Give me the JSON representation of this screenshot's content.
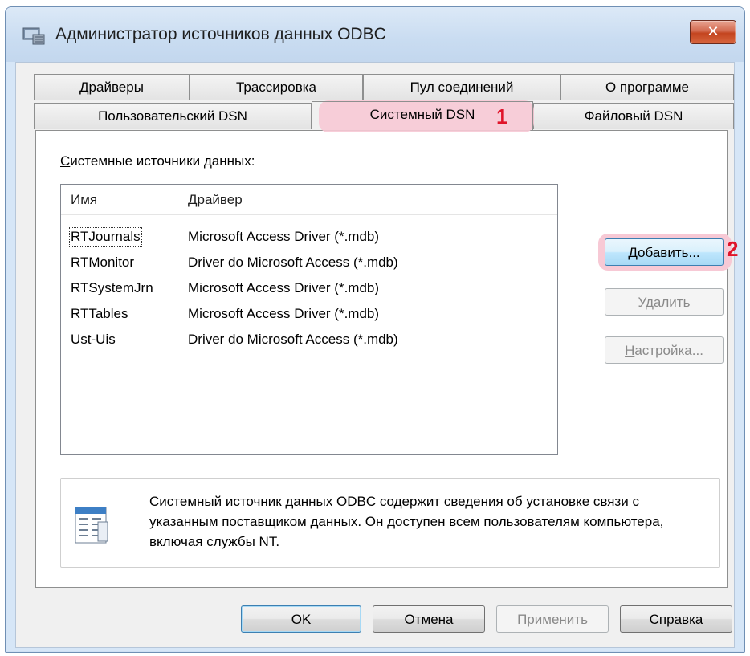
{
  "window": {
    "title": "Администратор источников данных ODBC",
    "close_label": "✕"
  },
  "tabs_back": [
    {
      "label": "Драйверы"
    },
    {
      "label": "Трассировка"
    },
    {
      "label": "Пул соединений"
    },
    {
      "label": "О программе"
    }
  ],
  "tabs_front": [
    {
      "label": "Пользовательский DSN"
    },
    {
      "label": "Системный DSN"
    },
    {
      "label": "Файловый DSN"
    }
  ],
  "annotations": {
    "tab_marker": "1",
    "add_marker": "2"
  },
  "panel": {
    "section_label_first": "С",
    "section_label_rest": "истемные источники данных:",
    "columns": {
      "name": "Имя",
      "driver": "Драйвер"
    },
    "rows": [
      {
        "name": "RTJournals",
        "driver": "Microsoft Access Driver (*.mdb)"
      },
      {
        "name": "RTMonitor",
        "driver": "Driver do Microsoft Access (*.mdb)"
      },
      {
        "name": "RTSystemJrn",
        "driver": "Microsoft Access Driver (*.mdb)"
      },
      {
        "name": "RTTables",
        "driver": "Microsoft Access Driver (*.mdb)"
      },
      {
        "name": "Ust-Uis",
        "driver": "Driver do Microsoft Access (*.mdb)"
      }
    ],
    "buttons": {
      "add_first": "Д",
      "add_rest": "обавить...",
      "remove_first": "У",
      "remove_rest": "далить",
      "configure_first": "Н",
      "configure_rest": "астройка..."
    },
    "info_text": "Системный источник данных ODBC содержит сведения об установке связи с указанным поставщиком данных. Он доступен всем пользователям компьютера, включая службы NT."
  },
  "footer": {
    "ok": "OK",
    "cancel": "Отмена",
    "apply_a": "При",
    "apply_u": "м",
    "apply_b": "енить",
    "help": "Справка"
  }
}
